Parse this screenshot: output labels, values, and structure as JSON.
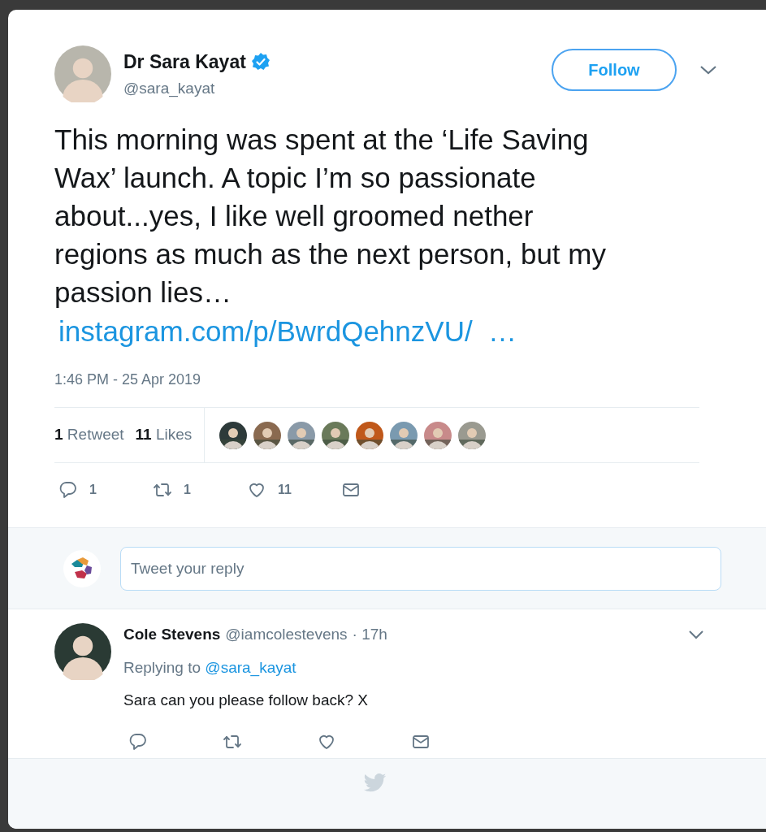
{
  "tweet": {
    "author": {
      "name": "Dr Sara Kayat",
      "handle": "@sara_kayat",
      "verified": true
    },
    "follow_button": "Follow",
    "text_lines": [
      "This morning was spent at the ‘Life Saving",
      "Wax’ launch. A topic I’m so passionate",
      "about...yes, I like well groomed nether",
      "regions as much as the next person, but my",
      "passion lies…"
    ],
    "link": "instagram.com/p/BwrdQehnzVU/  …",
    "timestamp": "1:46 PM - 25 Apr 2019",
    "stats": [
      {
        "count": "1",
        "label": "Retweet"
      },
      {
        "count": "11",
        "label": "Likes"
      }
    ],
    "actions": [
      {
        "kind": "reply",
        "count": "1"
      },
      {
        "kind": "retweet",
        "count": "1"
      },
      {
        "kind": "like",
        "count": "11"
      },
      {
        "kind": "message"
      }
    ]
  },
  "reply_box": {
    "placeholder": "Tweet your reply"
  },
  "replies": [
    {
      "name": "Cole Stevens",
      "handle": "@iamcolestevens",
      "time": "· 17h",
      "replying_label": "Replying to",
      "replying_to": "@sara_kayat",
      "text": "Sara can you please follow back? X",
      "actions": [
        {
          "kind": "reply"
        },
        {
          "kind": "retweet"
        },
        {
          "kind": "like"
        },
        {
          "kind": "message"
        }
      ]
    }
  ]
}
